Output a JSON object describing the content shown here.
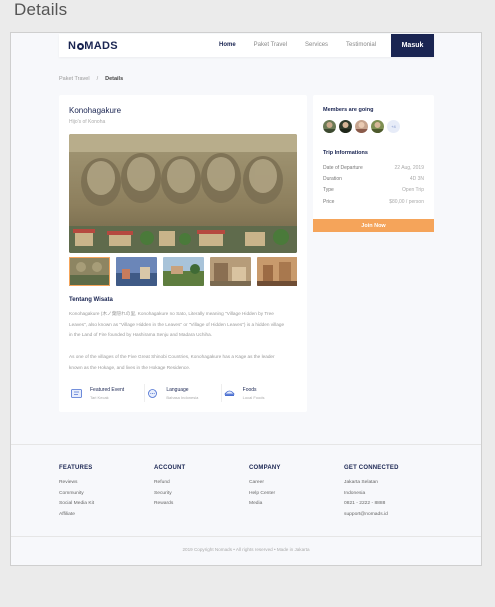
{
  "page_heading": "Details",
  "navbar": {
    "logo": "NOMADS",
    "links": [
      "Home",
      "Paket Travel",
      "Services",
      "Testimonial"
    ],
    "active": "Home",
    "login_label": "Masuk"
  },
  "breadcrumb": {
    "parent": "Paket Travel",
    "separator": "/",
    "current": "Details"
  },
  "detail": {
    "title": "Konohagakure",
    "subtitle": "Hijo's of Konoha",
    "about_title": "Tentang Wisata",
    "paragraph1": "Konohagakure (木ノ葉隠れの里, Konohagakure no Sato, Literally meaning \"Village Hidden by Tree Leaves\", also known as \"Village Hidden in the Leaves\" or \"Village of Hidden Leaves\") is a hidden village in the Land of Fire founded by Hashirama Senju and Madara Uchiha.",
    "paragraph2": "As one of the villages of the Five Great Shinobi Countries, Konohagakure has a Kage as the leader known as the Hokage, and lives in the Hokage Residence.",
    "features": [
      {
        "icon": "ticket-icon",
        "title": "Featured Event",
        "sub": "Tari Kecak"
      },
      {
        "icon": "chat-icon",
        "title": "Language",
        "sub": "Bahasa Indonesia"
      },
      {
        "icon": "food-icon",
        "title": "Foods",
        "sub": "Local Foods"
      }
    ]
  },
  "sidebar": {
    "members_title": "Members are going",
    "more_members": "+4",
    "trip_title": "Trip Informations",
    "info": [
      {
        "label": "Date of Departure",
        "value": "22 Aug, 2019"
      },
      {
        "label": "Duration",
        "value": "4D 3N"
      },
      {
        "label": "Type",
        "value": "Open Trip"
      },
      {
        "label": "Price",
        "value": "$80,00 / person"
      }
    ],
    "join_label": "Join Now"
  },
  "footer": {
    "columns": [
      {
        "title": "FEATURES",
        "links": [
          "Reviews",
          "Community",
          "Social Media Kit",
          "Affiliate"
        ]
      },
      {
        "title": "ACCOUNT",
        "links": [
          "Refund",
          "Security",
          "Rewards"
        ]
      },
      {
        "title": "COMPANY",
        "links": [
          "Career",
          "Help Center",
          "Media"
        ]
      },
      {
        "title": "GET CONNECTED",
        "links": [
          "Jakarta Selatan",
          "Indonesia",
          "0821 - 2222 - 8888",
          "support@nomads.id"
        ]
      }
    ],
    "copyright": "2019 Copyright Nomads • All rights reserved • Made in Jakarta"
  },
  "colors": {
    "primary": "#1a2552",
    "accent": "#f5a45a"
  }
}
